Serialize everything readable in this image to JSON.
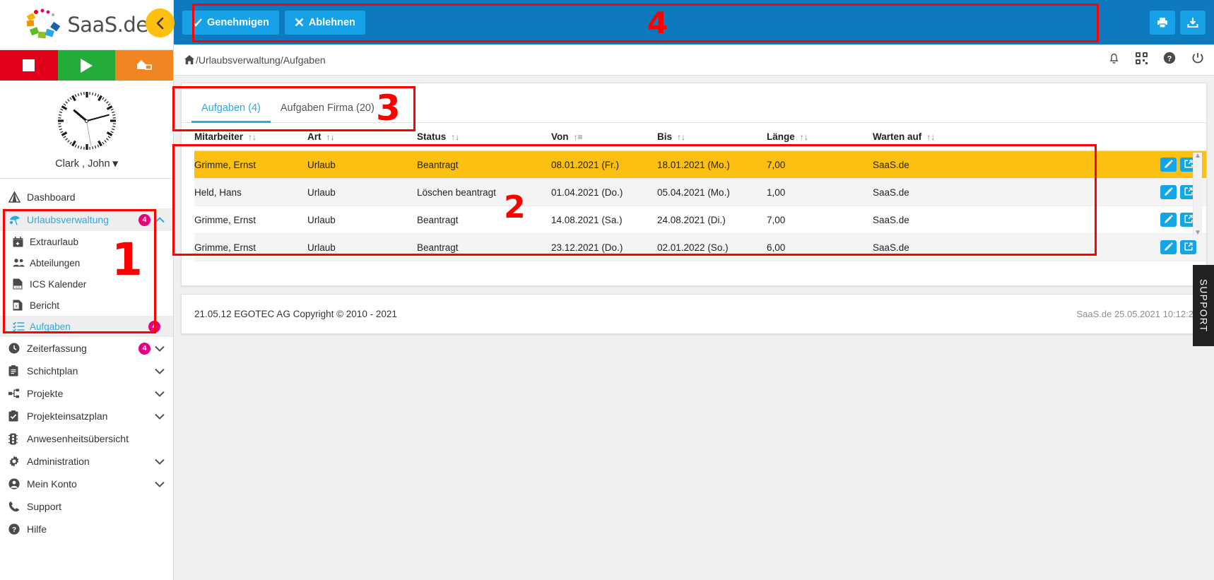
{
  "brand": {
    "name": "SaaS.de"
  },
  "quickbar": [
    {
      "name": "stop",
      "color": "#e3001b"
    },
    {
      "name": "play",
      "color": "#23ac38"
    },
    {
      "name": "home-office",
      "color": "#f08521"
    }
  ],
  "user": {
    "name": "Clark , John",
    "caret": "⌄"
  },
  "sidebar": {
    "items": [
      {
        "label": "Dashboard",
        "icon": "dashboard-icon",
        "badge": "",
        "chevron": "",
        "active": false,
        "sub": false
      },
      {
        "label": "Urlaubsverwaltung",
        "icon": "beach-icon",
        "badge": "4",
        "chevron": "up",
        "active": true,
        "sub": false
      },
      {
        "label": "Extraurlaub",
        "icon": "calendar-plus-icon",
        "badge": "",
        "chevron": "",
        "active": false,
        "sub": true
      },
      {
        "label": "Abteilungen",
        "icon": "people-icon",
        "badge": "",
        "chevron": "",
        "active": false,
        "sub": true
      },
      {
        "label": "ICS Kalender",
        "icon": "ics-file-icon",
        "badge": "",
        "chevron": "",
        "active": false,
        "sub": true
      },
      {
        "label": "Bericht",
        "icon": "excel-file-icon",
        "badge": "",
        "chevron": "",
        "active": false,
        "sub": true
      },
      {
        "label": "Aufgaben",
        "icon": "tasklist-icon",
        "badge": "4",
        "chevron": "",
        "active": true,
        "sub": true
      },
      {
        "label": "Zeiterfassung",
        "icon": "clock-icon",
        "badge": "4",
        "chevron": "down",
        "active": false,
        "sub": false
      },
      {
        "label": "Schichtplan",
        "icon": "clipboard-icon",
        "badge": "",
        "chevron": "down",
        "active": false,
        "sub": false
      },
      {
        "label": "Projekte",
        "icon": "sitemap-icon",
        "badge": "",
        "chevron": "down",
        "active": false,
        "sub": false
      },
      {
        "label": "Projekteinsatzplan",
        "icon": "clipboard-check-icon",
        "badge": "",
        "chevron": "down",
        "active": false,
        "sub": false
      },
      {
        "label": "Anwesenheitsübersicht",
        "icon": "traffic-light-icon",
        "badge": "",
        "chevron": "",
        "active": false,
        "sub": false
      },
      {
        "label": "Administration",
        "icon": "gear-icon",
        "badge": "",
        "chevron": "down",
        "active": false,
        "sub": false
      },
      {
        "label": "Mein Konto",
        "icon": "user-circle-icon",
        "badge": "",
        "chevron": "down",
        "active": false,
        "sub": false
      },
      {
        "label": "Support",
        "icon": "phone-icon",
        "badge": "",
        "chevron": "",
        "active": false,
        "sub": false
      },
      {
        "label": "Hilfe",
        "icon": "question-circle-icon",
        "badge": "",
        "chevron": "",
        "active": false,
        "sub": false
      }
    ]
  },
  "toolbar": {
    "approve_label": "Genehmigen",
    "reject_label": "Ablehnen",
    "print_icon": "printer-icon",
    "download_icon": "download-icon",
    "background": "#0f79c0",
    "button_color": "#17a2e8"
  },
  "collapse_toggle": {
    "icon": "chevron-left-icon",
    "color": "#fdc010"
  },
  "breadcrumb": {
    "home_icon": "home-icon",
    "path": "/Urlaubsverwaltung/Aufgaben",
    "right_icons": [
      "bell-icon",
      "qr-code-icon",
      "help-circle-icon",
      "power-icon"
    ]
  },
  "main": {
    "tabs": [
      {
        "label": "Aufgaben (4)",
        "active": true
      },
      {
        "label": "Aufgaben Firma (20)",
        "active": false
      }
    ],
    "table": {
      "columns": [
        {
          "label": "Mitarbeiter",
          "sort": "↑↓"
        },
        {
          "label": "Art",
          "sort": "↑↓"
        },
        {
          "label": "Status",
          "sort": "↑↓"
        },
        {
          "label": "Von",
          "sort": "↑≡"
        },
        {
          "label": "Bis",
          "sort": "↑↓"
        },
        {
          "label": "Länge",
          "sort": "↑↓"
        },
        {
          "label": "Warten auf",
          "sort": "↑↓"
        }
      ],
      "rows": [
        {
          "mitarbeiter": "Grimme, Ernst",
          "art": "Urlaub",
          "status": "Beantragt",
          "von": "08.01.2021 (Fr.)",
          "bis": "18.01.2021 (Mo.)",
          "laenge": "7,00",
          "warten_auf": "SaaS.de",
          "highlight": true
        },
        {
          "mitarbeiter": "Held, Hans",
          "art": "Urlaub",
          "status": "Löschen beantragt",
          "von": "01.04.2021 (Do.)",
          "bis": "05.04.2021 (Mo.)",
          "laenge": "1,00",
          "warten_auf": "SaaS.de",
          "highlight": false
        },
        {
          "mitarbeiter": "Grimme, Ernst",
          "art": "Urlaub",
          "status": "Beantragt",
          "von": "14.08.2021 (Sa.)",
          "bis": "24.08.2021 (Di.)",
          "laenge": "7,00",
          "warten_auf": "SaaS.de",
          "highlight": false
        },
        {
          "mitarbeiter": "Grimme, Ernst",
          "art": "Urlaub",
          "status": "Beantragt",
          "von": "23.12.2021 (Do.)",
          "bis": "02.01.2022 (So.)",
          "laenge": "6,00",
          "warten_auf": "SaaS.de",
          "highlight": false
        }
      ],
      "row_actions": [
        {
          "icon": "pencil-icon",
          "name": "edit-row-button"
        },
        {
          "icon": "external-link-icon",
          "name": "open-row-button"
        }
      ],
      "highlight_color": "#fbc011"
    }
  },
  "footer": {
    "left": "21.05.12 EGOTEC AG Copyright © 2010 - 2021",
    "right": "SaaS.de  25.05.2021 10:12:2"
  },
  "support_tab": {
    "label": "SUPPORT"
  },
  "annotations": [
    {
      "number": "1"
    },
    {
      "number": "2"
    },
    {
      "number": "3"
    },
    {
      "number": "4"
    }
  ]
}
